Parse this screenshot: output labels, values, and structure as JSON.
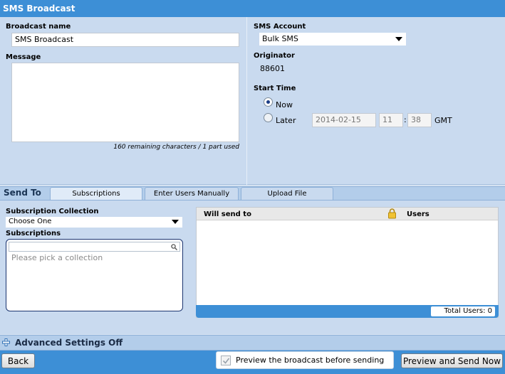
{
  "window": {
    "title": "SMS Broadcast"
  },
  "broadcast": {
    "name_label": "Broadcast name",
    "name_value": "SMS Broadcast",
    "message_label": "Message",
    "message_value": "",
    "char_counter": "160 remaining characters / 1 part used"
  },
  "account": {
    "label": "SMS Account",
    "selected": "Bulk SMS",
    "originator_label": "Originator",
    "originator_value": "88601"
  },
  "start_time": {
    "label": "Start Time",
    "now_label": "Now",
    "later_label": "Later",
    "selected": "Now",
    "date": "2014-02-15",
    "hour": "11",
    "separator": ":",
    "minute": "38",
    "timezone": "GMT"
  },
  "send_to": {
    "label": "Send To",
    "tabs": [
      {
        "label": "Subscriptions",
        "active": true
      },
      {
        "label": "Enter Users Manually",
        "active": false
      },
      {
        "label": "Upload File",
        "active": false
      }
    ]
  },
  "subscriptions": {
    "collection_label": "Subscription Collection",
    "collection_selected": "Choose One",
    "list_label": "Subscriptions",
    "search_placeholder": "",
    "empty_text": "Please pick a collection"
  },
  "recipients": {
    "col_will_send": "Will send to",
    "col_users": "Users",
    "total_label": "Total Users: 0"
  },
  "advanced": {
    "label": "Advanced Settings Off"
  },
  "footer": {
    "back_label": "Back",
    "preview_checkbox_label": "Preview the broadcast before sending",
    "preview_checked": true,
    "preview_send_label": "Preview and Send Now"
  },
  "colors": {
    "accent": "#3d8fd6",
    "panel": "#c9daef",
    "bar": "#b3cdea"
  }
}
